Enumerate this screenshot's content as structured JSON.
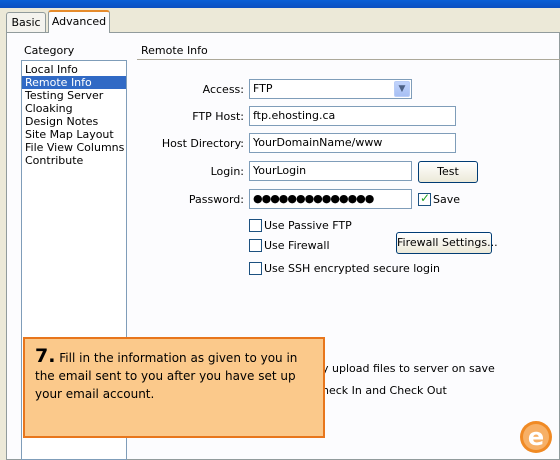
{
  "tabs": {
    "basic": "Basic",
    "advanced": "Advanced"
  },
  "category": {
    "label": "Category",
    "items": [
      "Local Info",
      "Remote Info",
      "Testing Server",
      "Cloaking",
      "Design Notes",
      "Site Map Layout",
      "File View Columns",
      "Contribute"
    ],
    "selected": "Remote Info"
  },
  "section": {
    "title": "Remote Info"
  },
  "form": {
    "access_label": "Access:",
    "access_value": "FTP",
    "ftp_host_label": "FTP Host:",
    "ftp_host_value": "ftp.ehosting.ca",
    "host_dir_label": "Host Directory:",
    "host_dir_value": "YourDomainName/www",
    "login_label": "Login:",
    "login_value": "YourLogin",
    "test_button": "Test",
    "password_label": "Password:",
    "password_value": "●●●●●●●●●●●●●●",
    "save_label": "Save",
    "save_checked": true,
    "passive_ftp_label": "Use Passive FTP",
    "passive_ftp_checked": false,
    "firewall_label": "Use Firewall",
    "firewall_checked": false,
    "firewall_settings_button": "Firewall Settings...",
    "ssh_label": "Use SSH encrypted secure login",
    "ssh_checked": false,
    "auto_upload_partial": "y upload files to server on save",
    "checkin_partial": "heck In and Check Out"
  },
  "callout": {
    "number": "7.",
    "text": "Fill in the information as given to you in the email sent to you after you have set up your email account."
  },
  "colors": {
    "selection": "#316ac5",
    "callout_bg": "#fbc98b",
    "callout_border": "#e8761c",
    "logo_orange": "#f08a24"
  },
  "logo": {
    "letter": "e"
  }
}
